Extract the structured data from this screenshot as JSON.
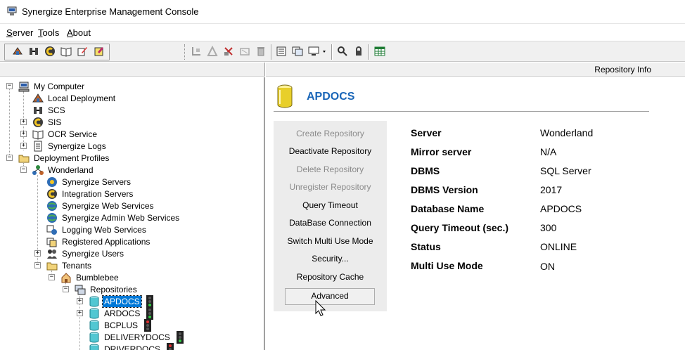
{
  "window": {
    "title": "Synergize Enterprise Management Console"
  },
  "menu": [
    "Server",
    "Tools",
    "About"
  ],
  "right_header": "Repository Info",
  "tree": {
    "nodes": [
      {
        "label": "My Computer",
        "icon": "computer-icon"
      },
      {
        "label": "Local Deployment",
        "icon": "deployment-icon"
      },
      {
        "label": "SCS",
        "icon": "scs-icon"
      },
      {
        "label": "SIS",
        "icon": "sis-icon"
      },
      {
        "label": "OCR Service",
        "icon": "book-icon"
      },
      {
        "label": "Synergize Logs",
        "icon": "logs-icon"
      },
      {
        "label": "Deployment Profiles",
        "icon": "folder-icon"
      },
      {
        "label": "Wonderland",
        "icon": "network-icon"
      },
      {
        "label": "Synergize Servers",
        "icon": "servers-icon"
      },
      {
        "label": "Integration Servers",
        "icon": "integration-icon"
      },
      {
        "label": "Synergize Web Services",
        "icon": "globe-icon"
      },
      {
        "label": "Synergize Admin Web Services",
        "icon": "globe-icon"
      },
      {
        "label": "Logging Web Services",
        "icon": "web-services-icon"
      },
      {
        "label": "Registered Applications",
        "icon": "applications-icon"
      },
      {
        "label": "Synergize Users",
        "icon": "users-icon"
      },
      {
        "label": "Tenants",
        "icon": "folder-open-icon"
      },
      {
        "label": "Bumblebee",
        "icon": "tenant-icon"
      },
      {
        "label": "Repositories",
        "icon": "repositories-icon"
      },
      {
        "label": "APDOCS",
        "icon": "database-icon"
      },
      {
        "label": "ARDOCS",
        "icon": "database-icon"
      },
      {
        "label": "BCPLUS",
        "icon": "database-icon"
      },
      {
        "label": "DELIVERYDOCS",
        "icon": "database-icon"
      },
      {
        "label": "DRIVERDOCS",
        "icon": "database-icon"
      }
    ]
  },
  "repository": {
    "name": "APDOCS",
    "actions": [
      {
        "label": "Create Repository",
        "enabled": false
      },
      {
        "label": "Deactivate Repository",
        "enabled": true
      },
      {
        "label": "Delete Repository",
        "enabled": false
      },
      {
        "label": "Unregister Repository",
        "enabled": false
      },
      {
        "label": "Query Timeout",
        "enabled": true
      },
      {
        "label": "DataBase Connection",
        "enabled": true
      },
      {
        "label": "Switch Multi Use Mode",
        "enabled": true
      },
      {
        "label": "Security...",
        "enabled": true
      },
      {
        "label": "Repository Cache",
        "enabled": true
      },
      {
        "label": "Advanced",
        "enabled": true
      }
    ],
    "info": [
      {
        "label": "Server",
        "value": "Wonderland"
      },
      {
        "label": "Mirror server",
        "value": "N/A"
      },
      {
        "label": "DBMS",
        "value": "SQL Server"
      },
      {
        "label": "DBMS Version",
        "value": "2017"
      },
      {
        "label": "Database Name",
        "value": "APDOCS"
      },
      {
        "label": "Query Timeout (sec.)",
        "value": "300"
      },
      {
        "label": "Status",
        "value": "ONLINE"
      },
      {
        "label": "Multi Use Mode",
        "value": "ON"
      }
    ]
  },
  "colors": {
    "accent_title": "#1a66b8",
    "selection": "#0078d7",
    "disabled_text": "#8a8a8a"
  }
}
